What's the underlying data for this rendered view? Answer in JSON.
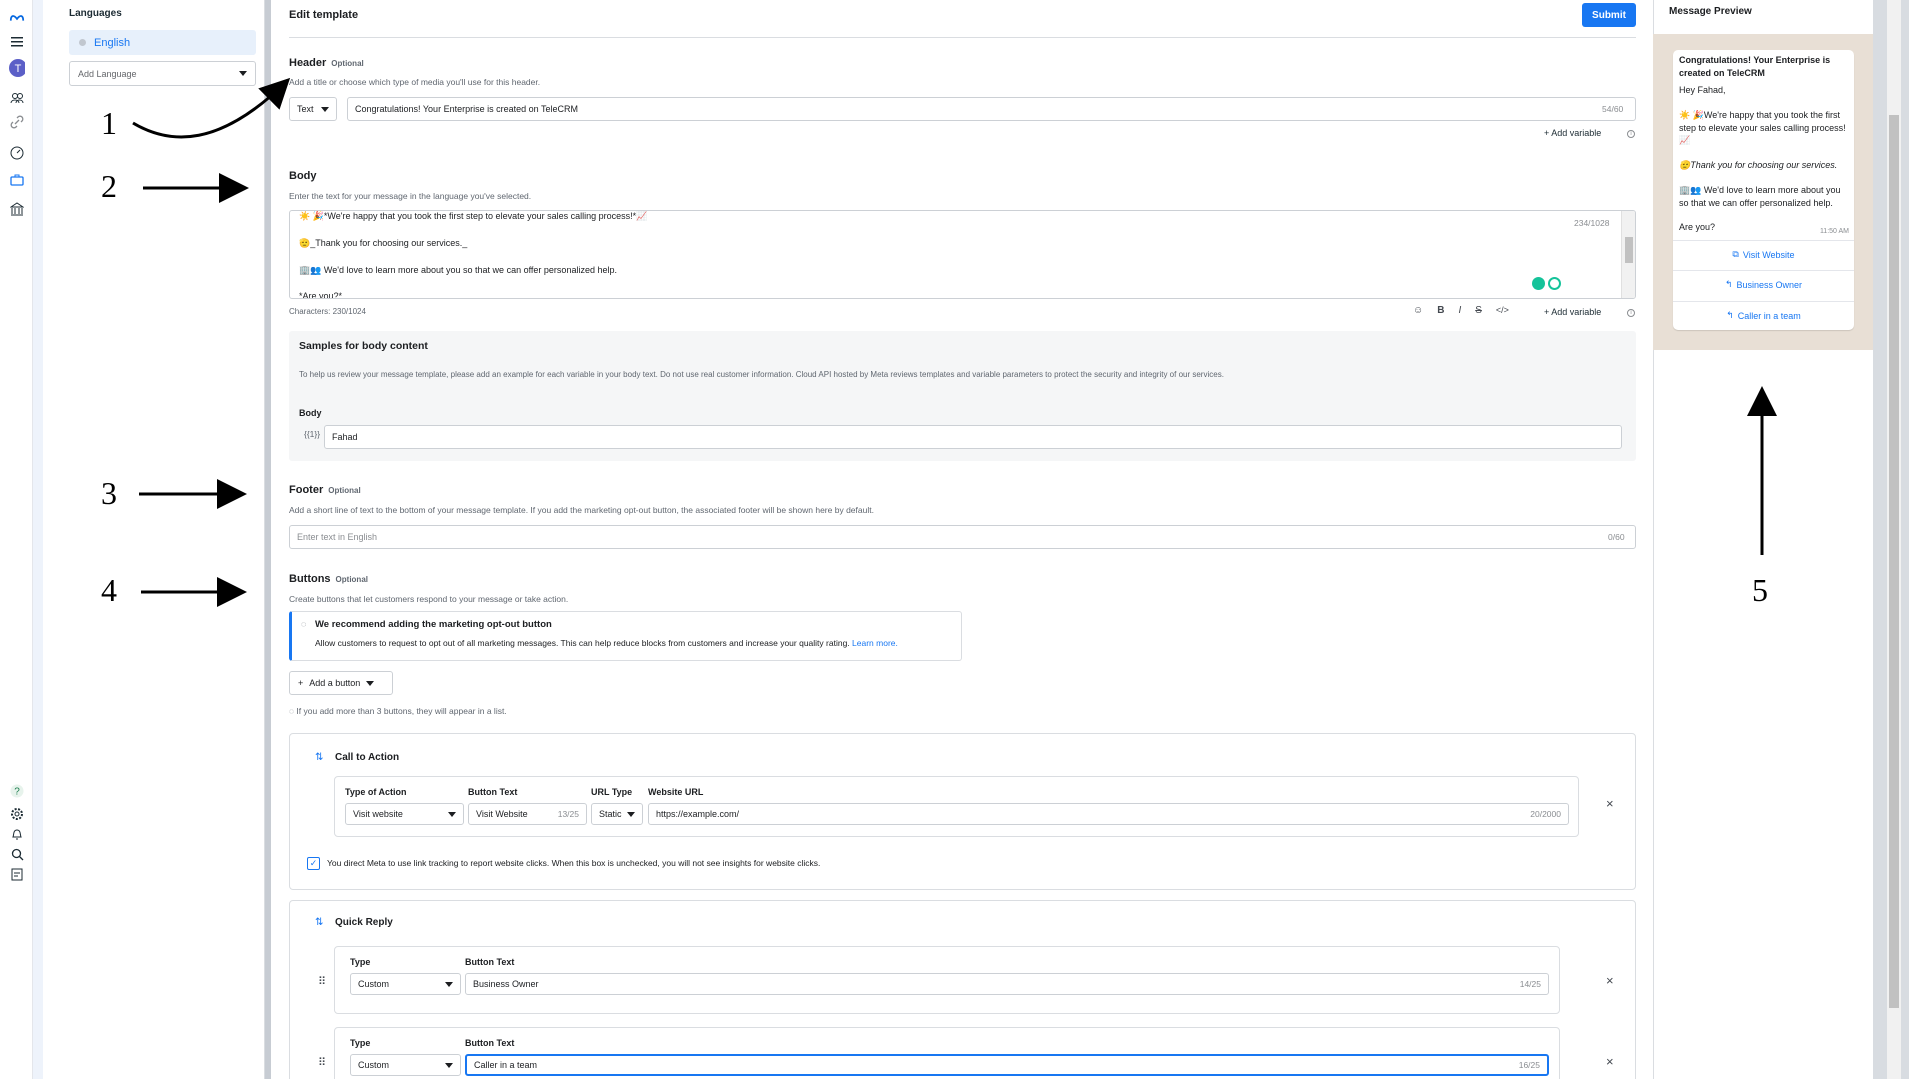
{
  "languages": {
    "title": "Languages",
    "selected": "English",
    "add_placeholder": "Add Language"
  },
  "editor": {
    "title": "Edit template",
    "submit": "Submit",
    "header": {
      "title": "Header",
      "optional": "Optional",
      "desc": "Add a title or choose which type of media you'll use for this header.",
      "type": "Text",
      "value": "Congratulations! Your Enterprise is created on TeleCRM",
      "count": "54/60",
      "add_variable": "Add variable"
    },
    "body": {
      "title": "Body",
      "desc": "Enter the text for your message in the language you've selected.",
      "lines": [
        "☀️ 🎉*We're happy that you took the first step to elevate your sales calling process!*📈",
        "🫡_Thank you for choosing our services._",
        "🏢👥 We'd love to learn more about you so that we can offer personalized help.",
        "*Are you?*"
      ],
      "count": "234/1028",
      "characters": "Characters: 230/1024",
      "add_variable": "Add variable",
      "toolbar": [
        "☺",
        "B",
        "I",
        "S",
        "</>"
      ]
    },
    "samples": {
      "title": "Samples for body content",
      "desc": "To help us review your message template, please add an example for each variable in your body text. Do not use real customer information. Cloud API hosted by Meta reviews templates and variable parameters to protect the security and integrity of our services.",
      "body_label": "Body",
      "var_label": "{{1}}",
      "var_value": "Fahad"
    },
    "footer": {
      "title": "Footer",
      "optional": "Optional",
      "desc": "Add a short line of text to the bottom of your message template. If you add the marketing opt-out button, the associated footer will be shown here by default.",
      "placeholder": "Enter text in English",
      "count": "0/60"
    },
    "buttons": {
      "title": "Buttons",
      "optional": "Optional",
      "desc": "Create buttons that let customers respond to your message or take action.",
      "banner_title": "We recommend adding the marketing opt-out button",
      "banner_text": "Allow customers to request to opt out of all marketing messages. This can help reduce blocks from customers and increase your quality rating.",
      "banner_link": "Learn more.",
      "add_button": "Add a button",
      "hint": "If you add more than 3 buttons, they will appear in a list.",
      "cta": {
        "title": "Call to Action",
        "type_label": "Type of Action",
        "type_value": "Visit website",
        "text_label": "Button Text",
        "text_value": "Visit Website",
        "text_count": "13/25",
        "url_type_label": "URL Type",
        "url_type_value": "Static",
        "url_label": "Website URL",
        "url_value": "https://example.com/",
        "url_count": "20/2000",
        "tracking": "You direct Meta to use link tracking to report website clicks. When this box is unchecked, you will not see insights for website clicks."
      },
      "quick_reply": {
        "title": "Quick Reply",
        "rows": [
          {
            "type_label": "Type",
            "type_value": "Custom",
            "text_label": "Button Text",
            "text_value": "Business Owner",
            "count": "14/25"
          },
          {
            "type_label": "Type",
            "type_value": "Custom",
            "text_label": "Button Text",
            "text_value": "Caller in a team",
            "count": "16/25"
          }
        ]
      }
    }
  },
  "preview": {
    "title": "Message Preview",
    "heading": "Congratulations! Your Enterprise is created on TeleCRM",
    "greeting": "Hey Fahad,",
    "p1": "☀️ 🎉We're happy that you took the first step to elevate your sales calling process!📈",
    "p2": "🫡Thank you for choosing our services.",
    "p3": "🏢👥 We'd love to learn more about you so that we can offer personalized help.",
    "p4": "Are you?",
    "time": "11:50 AM",
    "buttons": [
      "Visit Website",
      "Business Owner",
      "Caller in a team"
    ]
  },
  "annotations": [
    "1",
    "2",
    "3",
    "4",
    "5"
  ],
  "colors": {
    "accent": "#1877f2",
    "chat_bg": "#e8dfd5"
  }
}
